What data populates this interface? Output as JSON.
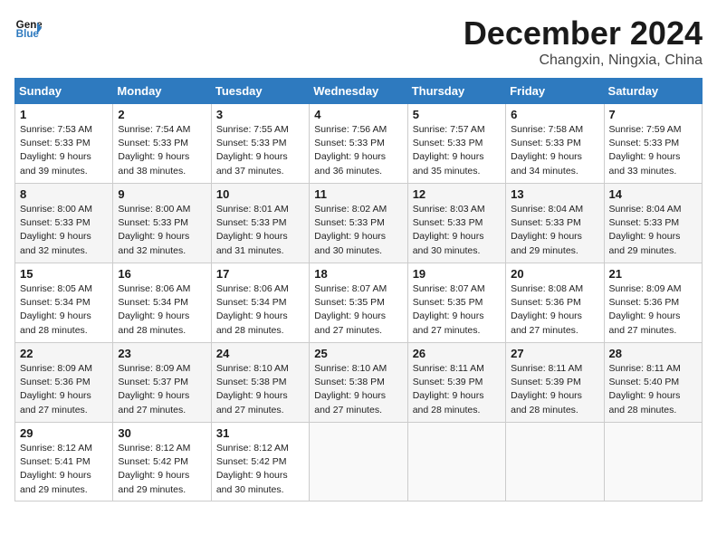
{
  "header": {
    "logo_line1": "General",
    "logo_line2": "Blue",
    "month": "December 2024",
    "location": "Changxin, Ningxia, China"
  },
  "days_of_week": [
    "Sunday",
    "Monday",
    "Tuesday",
    "Wednesday",
    "Thursday",
    "Friday",
    "Saturday"
  ],
  "weeks": [
    [
      {
        "num": "1",
        "rise": "7:53 AM",
        "set": "5:33 PM",
        "daylight": "9 hours and 39 minutes."
      },
      {
        "num": "2",
        "rise": "7:54 AM",
        "set": "5:33 PM",
        "daylight": "9 hours and 38 minutes."
      },
      {
        "num": "3",
        "rise": "7:55 AM",
        "set": "5:33 PM",
        "daylight": "9 hours and 37 minutes."
      },
      {
        "num": "4",
        "rise": "7:56 AM",
        "set": "5:33 PM",
        "daylight": "9 hours and 36 minutes."
      },
      {
        "num": "5",
        "rise": "7:57 AM",
        "set": "5:33 PM",
        "daylight": "9 hours and 35 minutes."
      },
      {
        "num": "6",
        "rise": "7:58 AM",
        "set": "5:33 PM",
        "daylight": "9 hours and 34 minutes."
      },
      {
        "num": "7",
        "rise": "7:59 AM",
        "set": "5:33 PM",
        "daylight": "9 hours and 33 minutes."
      }
    ],
    [
      {
        "num": "8",
        "rise": "8:00 AM",
        "set": "5:33 PM",
        "daylight": "9 hours and 32 minutes."
      },
      {
        "num": "9",
        "rise": "8:00 AM",
        "set": "5:33 PM",
        "daylight": "9 hours and 32 minutes."
      },
      {
        "num": "10",
        "rise": "8:01 AM",
        "set": "5:33 PM",
        "daylight": "9 hours and 31 minutes."
      },
      {
        "num": "11",
        "rise": "8:02 AM",
        "set": "5:33 PM",
        "daylight": "9 hours and 30 minutes."
      },
      {
        "num": "12",
        "rise": "8:03 AM",
        "set": "5:33 PM",
        "daylight": "9 hours and 30 minutes."
      },
      {
        "num": "13",
        "rise": "8:04 AM",
        "set": "5:33 PM",
        "daylight": "9 hours and 29 minutes."
      },
      {
        "num": "14",
        "rise": "8:04 AM",
        "set": "5:33 PM",
        "daylight": "9 hours and 29 minutes."
      }
    ],
    [
      {
        "num": "15",
        "rise": "8:05 AM",
        "set": "5:34 PM",
        "daylight": "9 hours and 28 minutes."
      },
      {
        "num": "16",
        "rise": "8:06 AM",
        "set": "5:34 PM",
        "daylight": "9 hours and 28 minutes."
      },
      {
        "num": "17",
        "rise": "8:06 AM",
        "set": "5:34 PM",
        "daylight": "9 hours and 28 minutes."
      },
      {
        "num": "18",
        "rise": "8:07 AM",
        "set": "5:35 PM",
        "daylight": "9 hours and 27 minutes."
      },
      {
        "num": "19",
        "rise": "8:07 AM",
        "set": "5:35 PM",
        "daylight": "9 hours and 27 minutes."
      },
      {
        "num": "20",
        "rise": "8:08 AM",
        "set": "5:36 PM",
        "daylight": "9 hours and 27 minutes."
      },
      {
        "num": "21",
        "rise": "8:09 AM",
        "set": "5:36 PM",
        "daylight": "9 hours and 27 minutes."
      }
    ],
    [
      {
        "num": "22",
        "rise": "8:09 AM",
        "set": "5:36 PM",
        "daylight": "9 hours and 27 minutes."
      },
      {
        "num": "23",
        "rise": "8:09 AM",
        "set": "5:37 PM",
        "daylight": "9 hours and 27 minutes."
      },
      {
        "num": "24",
        "rise": "8:10 AM",
        "set": "5:38 PM",
        "daylight": "9 hours and 27 minutes."
      },
      {
        "num": "25",
        "rise": "8:10 AM",
        "set": "5:38 PM",
        "daylight": "9 hours and 27 minutes."
      },
      {
        "num": "26",
        "rise": "8:11 AM",
        "set": "5:39 PM",
        "daylight": "9 hours and 28 minutes."
      },
      {
        "num": "27",
        "rise": "8:11 AM",
        "set": "5:39 PM",
        "daylight": "9 hours and 28 minutes."
      },
      {
        "num": "28",
        "rise": "8:11 AM",
        "set": "5:40 PM",
        "daylight": "9 hours and 28 minutes."
      }
    ],
    [
      {
        "num": "29",
        "rise": "8:12 AM",
        "set": "5:41 PM",
        "daylight": "9 hours and 29 minutes."
      },
      {
        "num": "30",
        "rise": "8:12 AM",
        "set": "5:42 PM",
        "daylight": "9 hours and 29 minutes."
      },
      {
        "num": "31",
        "rise": "8:12 AM",
        "set": "5:42 PM",
        "daylight": "9 hours and 30 minutes."
      },
      null,
      null,
      null,
      null
    ]
  ]
}
